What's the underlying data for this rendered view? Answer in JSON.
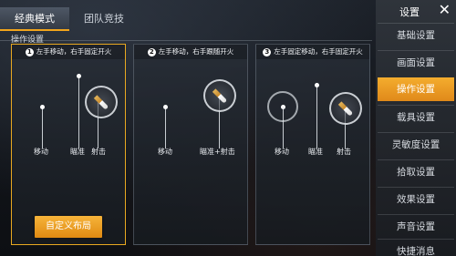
{
  "tabs": [
    {
      "label": "经典模式",
      "active": true
    },
    {
      "label": "团队竞技",
      "active": false
    }
  ],
  "section_title": "操作设置",
  "panels": [
    {
      "number": "1",
      "header": "左手移动，右手固定开火",
      "labels": [
        "移动",
        "瞄准",
        "射击"
      ],
      "selected": true,
      "button_label": "自定义布局"
    },
    {
      "number": "2",
      "header": "左手移动，右手跟随开火",
      "labels": [
        "移动",
        "瞄准+射击"
      ],
      "selected": false
    },
    {
      "number": "3",
      "header": "左手固定移动，右手固定开火",
      "labels": [
        "移动",
        "瞄准",
        "射击"
      ],
      "selected": false
    }
  ],
  "sidebar": {
    "title": "设置",
    "close_icon": "close-icon",
    "items": [
      {
        "label": "基础设置",
        "active": false
      },
      {
        "label": "画面设置",
        "active": false
      },
      {
        "label": "操作设置",
        "active": true
      },
      {
        "label": "载具设置",
        "active": false
      },
      {
        "label": "灵敏度设置",
        "active": false
      },
      {
        "label": "拾取设置",
        "active": false
      },
      {
        "label": "效果设置",
        "active": false
      },
      {
        "label": "声音设置",
        "active": false
      },
      {
        "label": "快捷消息",
        "active": false
      }
    ]
  },
  "colors": {
    "accent": "#f2a51c",
    "panel_border_selected": "#e8a820"
  }
}
